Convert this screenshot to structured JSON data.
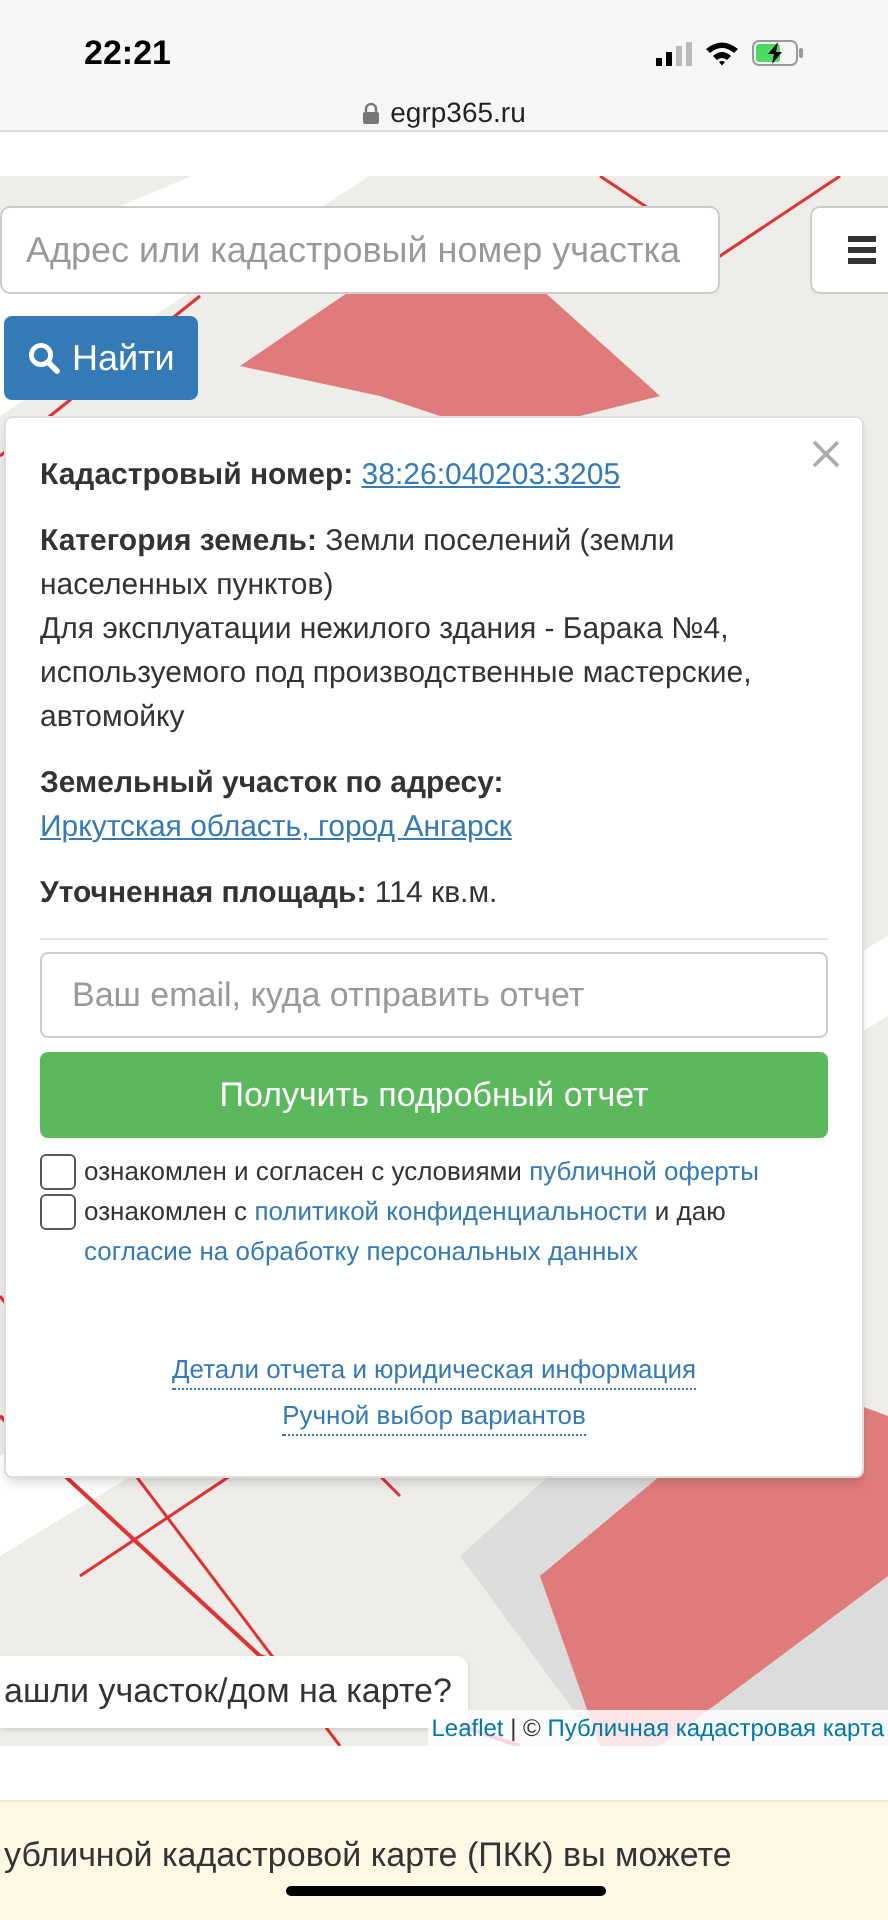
{
  "status_bar": {
    "time": "22:21"
  },
  "browser": {
    "url": "egrp365.ru"
  },
  "search": {
    "placeholder": "Адрес или кадастровый номер участка",
    "button": "Найти"
  },
  "popup": {
    "fields": [
      {
        "label": "Кадастровый номер:",
        "value": "38:26:040203:3205",
        "kind": "link"
      },
      {
        "label": "Категория земель:",
        "value": "Земли поселений (земли населенных пунктов)",
        "note": "Для эксплуатации нежилого здания - Барака №4, используемого под производственные мастерские, автомойку",
        "kind": "text"
      },
      {
        "label": "Земельный участок по адресу:",
        "value": "Иркутская область, город Ангарск",
        "kind": "link"
      },
      {
        "label": "Уточненная площадь:",
        "value": "114 кв.м.",
        "kind": "text"
      }
    ],
    "email": {
      "placeholder": "Ваш email, куда отправить отчет"
    },
    "submit": "Получить подробный отчет",
    "consents": [
      {
        "checked": false,
        "parts": [
          {
            "text": "ознакомлен и согласен с условиями ",
            "link": false
          },
          {
            "text": "публичной оферты",
            "link": true
          }
        ]
      },
      {
        "checked": false,
        "parts": [
          {
            "text": "ознакомлен с ",
            "link": false
          },
          {
            "text": "политикой конфиденциальности",
            "link": true
          },
          {
            "text": " и даю ",
            "link": false
          },
          {
            "text": "согласие на обработку персональных данных",
            "link": true
          }
        ]
      }
    ],
    "links": [
      "Детали отчета и юридическая информация",
      "Ручной выбор вариантов"
    ]
  },
  "map_prompt": "ашли участок/дом на карте?",
  "attribution": [
    {
      "text": "Leaflet",
      "link": true
    },
    {
      "text": " | © ",
      "link": false
    },
    {
      "text": "Публичная кадастровая карта",
      "link": true
    }
  ],
  "info": {
    "text": "убличной кадастровой карте (ПКК) вы можете"
  }
}
